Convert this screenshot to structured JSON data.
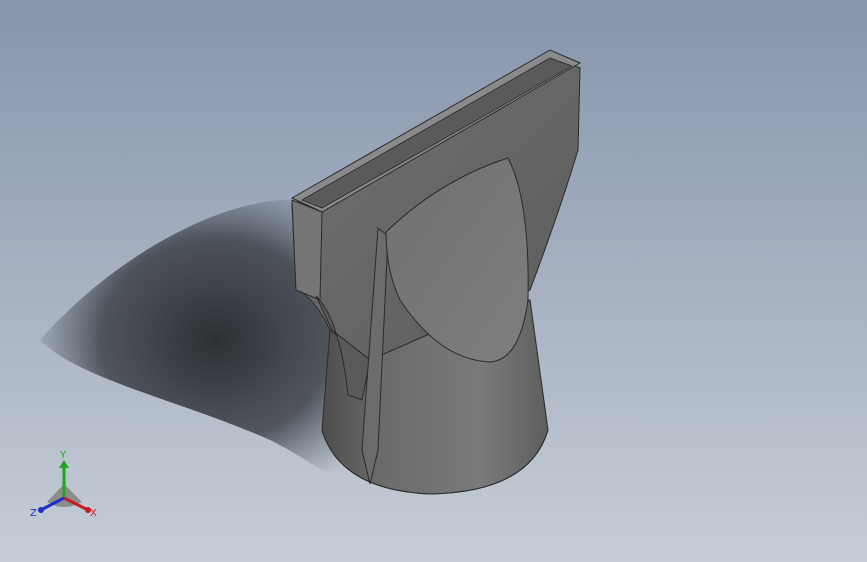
{
  "viewport": {
    "background_top": "#8795ad",
    "background_bottom": "#c6cdd6"
  },
  "model": {
    "body_color": "#6e6e6e",
    "edge_color": "#2a2a2a",
    "shadow_color": "#2f3237"
  },
  "triad": {
    "x_label": "X",
    "y_label": "Y",
    "z_label": "Z",
    "x_color": "#c81e1e",
    "y_color": "#1fa81f",
    "z_color": "#1e2ec8"
  }
}
